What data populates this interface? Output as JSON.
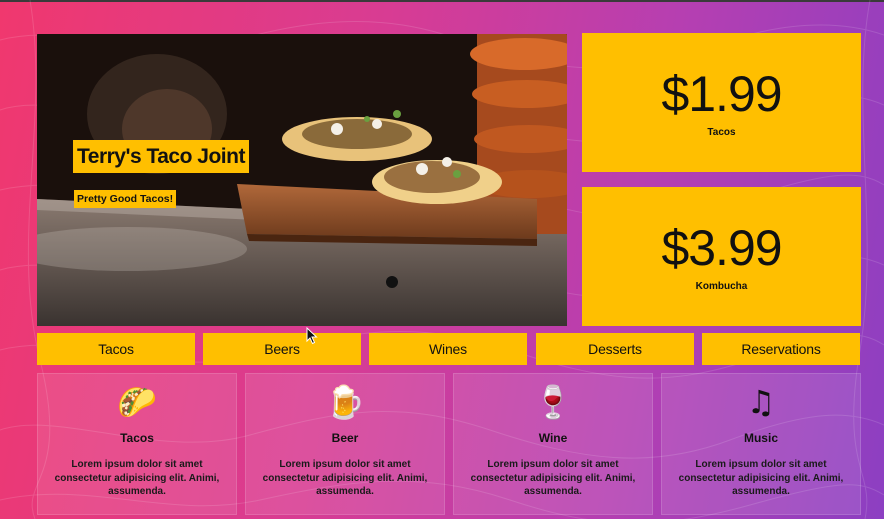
{
  "hero": {
    "title": "Terry's Taco Joint",
    "subtitle": "Pretty Good Tacos!"
  },
  "prices": [
    {
      "amount": "$1.99",
      "label": "Tacos"
    },
    {
      "amount": "$3.99",
      "label": "Kombucha"
    }
  ],
  "nav": [
    "Tacos",
    "Beers",
    "Wines",
    "Desserts",
    "Reservations"
  ],
  "cards": [
    {
      "icon": "taco-icon",
      "glyph": "🌮",
      "title": "Tacos",
      "text": "Lorem ipsum dolor sit amet consectetur adipisicing elit. Animi, assumenda."
    },
    {
      "icon": "beer-mug-icon",
      "glyph": "🍺",
      "title": "Beer",
      "text": "Lorem ipsum dolor sit amet consectetur adipisicing elit. Animi, assumenda."
    },
    {
      "icon": "wine-glass-icon",
      "glyph": "🍷",
      "title": "Wine",
      "text": "Lorem ipsum dolor sit amet consectetur adipisicing elit. Animi, assumenda."
    },
    {
      "icon": "music-notes-icon",
      "glyph": "♫",
      "title": "Music",
      "text": "Lorem ipsum dolor sit amet consectetur adipisicing elit. Animi, assumenda."
    }
  ],
  "colors": {
    "accent": "#ffbf00",
    "background_start": "#f0386e",
    "background_end": "#8c3fc2"
  }
}
